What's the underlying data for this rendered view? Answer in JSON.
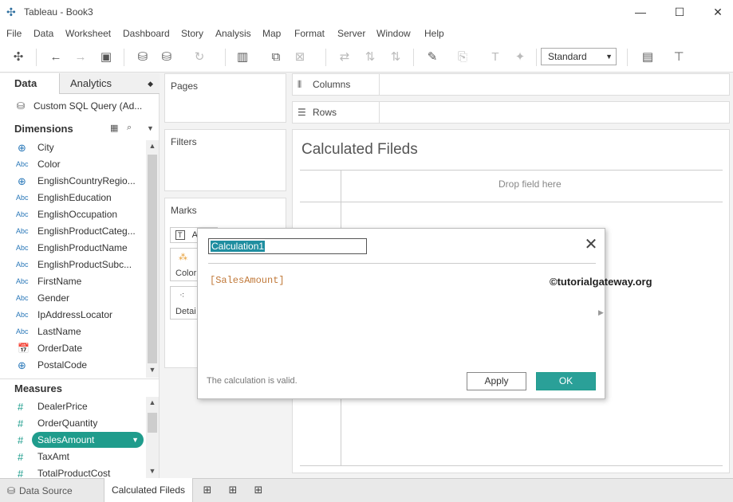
{
  "window": {
    "title": "Tableau - Book3",
    "controls": {
      "minimize": "—",
      "maximize": "☐",
      "close": "✕"
    }
  },
  "menu": [
    "File",
    "Data",
    "Worksheet",
    "Dashboard",
    "Story",
    "Analysis",
    "Map",
    "Format",
    "Server",
    "Window",
    "Help"
  ],
  "toolbar": {
    "fit_value": "Standard"
  },
  "data_pane": {
    "tabs": {
      "data": "Data",
      "analytics": "Analytics"
    },
    "datasource": "Custom SQL Query (Ad...",
    "dimensions_title": "Dimensions",
    "dimensions": [
      {
        "type": "globe",
        "glyph": "⊕",
        "name": "City"
      },
      {
        "type": "abc",
        "glyph": "Abc",
        "name": "Color"
      },
      {
        "type": "globe",
        "glyph": "⊕",
        "name": "EnglishCountryRegio..."
      },
      {
        "type": "abc",
        "glyph": "Abc",
        "name": "EnglishEducation"
      },
      {
        "type": "abc",
        "glyph": "Abc",
        "name": "EnglishOccupation"
      },
      {
        "type": "abc",
        "glyph": "Abc",
        "name": "EnglishProductCateg..."
      },
      {
        "type": "abc",
        "glyph": "Abc",
        "name": "EnglishProductName"
      },
      {
        "type": "abc",
        "glyph": "Abc",
        "name": "EnglishProductSubc..."
      },
      {
        "type": "abc",
        "glyph": "Abc",
        "name": "FirstName"
      },
      {
        "type": "abc",
        "glyph": "Abc",
        "name": "Gender"
      },
      {
        "type": "abc",
        "glyph": "Abc",
        "name": "IpAddressLocator"
      },
      {
        "type": "abc",
        "glyph": "Abc",
        "name": "LastName"
      },
      {
        "type": "date",
        "glyph": "📅",
        "name": "OrderDate"
      },
      {
        "type": "globe",
        "glyph": "⊕",
        "name": "PostalCode"
      }
    ],
    "measures_title": "Measures",
    "measures": [
      {
        "type": "hash",
        "glyph": "#",
        "name": "DealerPrice"
      },
      {
        "type": "hash",
        "glyph": "#",
        "name": "OrderQuantity"
      },
      {
        "type": "hash",
        "glyph": "#",
        "name": "SalesAmount"
      },
      {
        "type": "hash",
        "glyph": "#",
        "name": "TaxAmt"
      },
      {
        "type": "hash",
        "glyph": "#",
        "name": "TotalProductCost"
      }
    ]
  },
  "cards": {
    "pages": "Pages",
    "filters": "Filters",
    "marks": "Marks",
    "marks_type": "A",
    "color": "Color",
    "detail": "Detai"
  },
  "shelves": {
    "columns": "Columns",
    "rows": "Rows"
  },
  "canvas": {
    "sheet_title": "Calculated Fileds",
    "drop_hint": "Drop field here"
  },
  "bottom": {
    "datasource_tab": "Data Source",
    "sheet_tab": "Calculated Fileds"
  },
  "calc_dialog": {
    "name": "Calculation1",
    "formula": "[SalesAmount]",
    "watermark": "©tutorialgateway.org",
    "status": "The calculation is valid.",
    "apply": "Apply",
    "ok": "OK",
    "close": "✕"
  },
  "colors": {
    "accent_teal": "#1f9c8c",
    "selection_blue": "#1f8ea0",
    "formula_orange": "#c07838"
  }
}
